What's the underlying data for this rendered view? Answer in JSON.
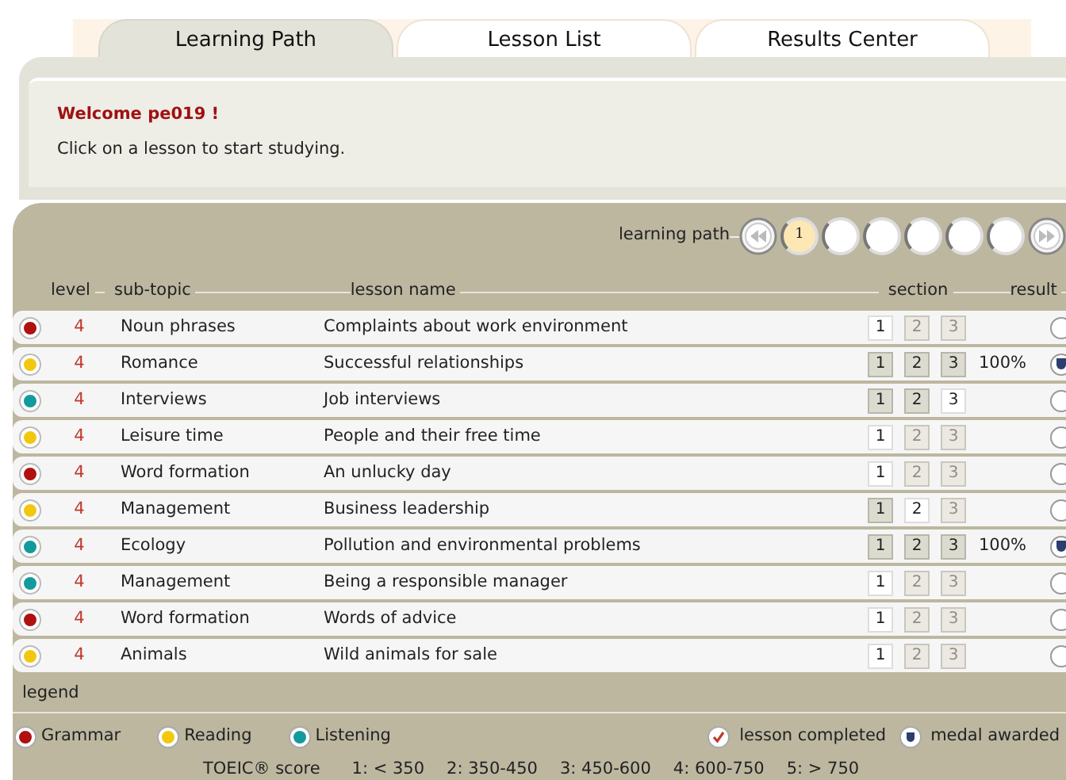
{
  "tabs": [
    {
      "label": "Learning Path",
      "selected": true
    },
    {
      "label": "Lesson List",
      "selected": false
    },
    {
      "label": "Results Center",
      "selected": false
    }
  ],
  "welcome": {
    "title": "Welcome pe019 !",
    "message": "Click on a lesson to start studying."
  },
  "learning_path": {
    "label": "learning path",
    "nodes": [
      {
        "label": "1",
        "selected": true
      },
      {
        "selected": false
      },
      {
        "selected": false
      },
      {
        "selected": false
      },
      {
        "selected": false
      },
      {
        "selected": false
      }
    ]
  },
  "table": {
    "columns": [
      "level",
      "sub-topic",
      "lesson name",
      "section",
      "result"
    ],
    "rows": [
      {
        "color": "#b01010",
        "level": "4",
        "sub_topic": "Noun phrases",
        "lesson": "Complaints about work environment",
        "sections": [
          {
            "label": "1",
            "completed": false,
            "disabled": false
          },
          {
            "label": "2",
            "completed": false,
            "disabled": true
          },
          {
            "label": "3",
            "completed": false,
            "disabled": true
          }
        ],
        "medal": false
      },
      {
        "color": "#f2c80f",
        "level": "4",
        "sub_topic": "Romance",
        "lesson": "Successful relationships",
        "sections": [
          {
            "label": "1",
            "completed": true,
            "disabled": false
          },
          {
            "label": "2",
            "completed": true,
            "disabled": false
          },
          {
            "label": "3",
            "completed": true,
            "disabled": false
          }
        ],
        "result": "100%",
        "medal": true
      },
      {
        "color": "#139a9c",
        "level": "4",
        "sub_topic": "Interviews",
        "lesson": "Job interviews",
        "sections": [
          {
            "label": "1",
            "completed": true,
            "disabled": false
          },
          {
            "label": "2",
            "completed": true,
            "disabled": false
          },
          {
            "label": "3",
            "completed": false,
            "disabled": false
          }
        ],
        "medal": false
      },
      {
        "color": "#f2c80f",
        "level": "4",
        "sub_topic": "Leisure time",
        "lesson": "People and their free time",
        "sections": [
          {
            "label": "1",
            "completed": false,
            "disabled": false
          },
          {
            "label": "2",
            "completed": false,
            "disabled": true
          },
          {
            "label": "3",
            "completed": false,
            "disabled": true
          }
        ],
        "medal": false
      },
      {
        "color": "#b01010",
        "level": "4",
        "sub_topic": "Word formation",
        "lesson": "An unlucky day",
        "sections": [
          {
            "label": "1",
            "completed": false,
            "disabled": false
          },
          {
            "label": "2",
            "completed": false,
            "disabled": true
          },
          {
            "label": "3",
            "completed": false,
            "disabled": true
          }
        ],
        "medal": false
      },
      {
        "color": "#f2c80f",
        "level": "4",
        "sub_topic": "Management",
        "lesson": "Business leadership",
        "sections": [
          {
            "label": "1",
            "completed": true,
            "disabled": false
          },
          {
            "label": "2",
            "completed": false,
            "disabled": false
          },
          {
            "label": "3",
            "completed": false,
            "disabled": true
          }
        ],
        "medal": false
      },
      {
        "color": "#139a9c",
        "level": "4",
        "sub_topic": "Ecology",
        "lesson": "Pollution and environmental problems",
        "sections": [
          {
            "label": "1",
            "completed": true,
            "disabled": false
          },
          {
            "label": "2",
            "completed": true,
            "disabled": false
          },
          {
            "label": "3",
            "completed": true,
            "disabled": false
          }
        ],
        "result": "100%",
        "medal": true
      },
      {
        "color": "#139a9c",
        "level": "4",
        "sub_topic": "Management",
        "lesson": "Being a responsible manager",
        "sections": [
          {
            "label": "1",
            "completed": false,
            "disabled": false
          },
          {
            "label": "2",
            "completed": false,
            "disabled": true
          },
          {
            "label": "3",
            "completed": false,
            "disabled": true
          }
        ],
        "medal": false
      },
      {
        "color": "#b01010",
        "level": "4",
        "sub_topic": "Word formation",
        "lesson": "Words of advice",
        "sections": [
          {
            "label": "1",
            "completed": false,
            "disabled": false
          },
          {
            "label": "2",
            "completed": false,
            "disabled": true
          },
          {
            "label": "3",
            "completed": false,
            "disabled": true
          }
        ],
        "medal": false
      },
      {
        "color": "#f2c80f",
        "level": "4",
        "sub_topic": "Animals",
        "lesson": "Wild animals for sale",
        "sections": [
          {
            "label": "1",
            "completed": false,
            "disabled": false
          },
          {
            "label": "2",
            "completed": false,
            "disabled": true
          },
          {
            "label": "3",
            "completed": false,
            "disabled": true
          }
        ],
        "medal": false
      }
    ]
  },
  "legend": {
    "title": "legend",
    "skills": [
      {
        "label": "Grammar",
        "color": "#b01010"
      },
      {
        "label": "Reading",
        "color": "#f2c80f"
      },
      {
        "label": "Listening",
        "color": "#139a9c"
      }
    ],
    "marks": [
      {
        "kind": "completed",
        "label": "lesson completed"
      },
      {
        "kind": "medal",
        "label": "medal awarded"
      }
    ],
    "score_title": "TOEIC® score",
    "scores": [
      "1: < 350",
      "2: 350-450",
      "3: 450-600",
      "4: 600-750",
      "5: > 750"
    ]
  }
}
